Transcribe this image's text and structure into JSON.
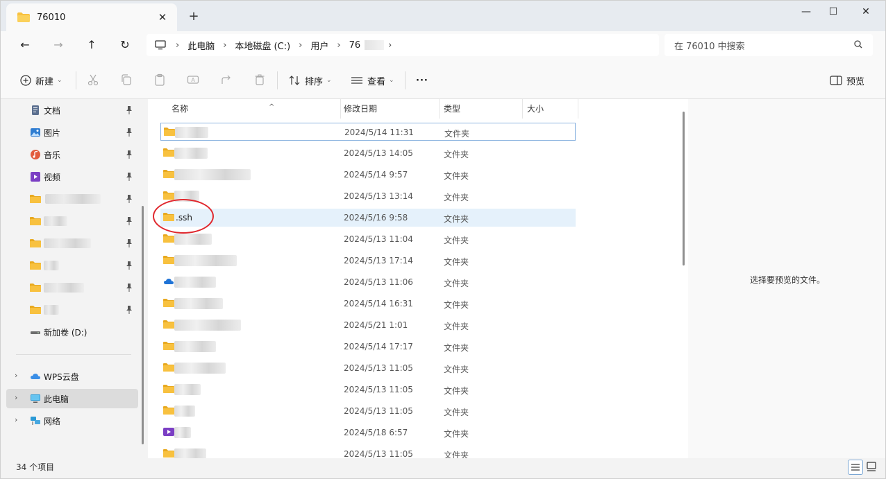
{
  "window": {
    "tab_title": "76010",
    "new_tab": "+",
    "tab_close": "✕",
    "controls": {
      "minimize": "—",
      "maximize": "☐",
      "close": "✕"
    }
  },
  "address": {
    "back": "←",
    "forward": "→",
    "up": "↑",
    "refresh": "↻",
    "breadcrumbs": [
      "此电脑",
      "本地磁盘 (C:)",
      "用户",
      "76"
    ],
    "separator": "›",
    "search_placeholder": "在 76010 中搜索"
  },
  "toolbar": {
    "new_label": "新建",
    "sort_label": "排序",
    "view_label": "查看",
    "more_label": "···",
    "preview_label": "预览",
    "caret": "⌄"
  },
  "sidebar": {
    "items": [
      {
        "label": "文档",
        "icon": "document-icon"
      },
      {
        "label": "图片",
        "icon": "pictures-icon"
      },
      {
        "label": "音乐",
        "icon": "music-icon"
      },
      {
        "label": "视频",
        "icon": "video-icon"
      },
      {
        "label": "",
        "icon": "folder-icon"
      },
      {
        "label": "",
        "icon": "folder-icon"
      },
      {
        "label": "",
        "icon": "folder-icon"
      },
      {
        "label": "",
        "icon": "folder-icon"
      },
      {
        "label": "",
        "icon": "folder-icon"
      },
      {
        "label": "",
        "icon": "folder-icon"
      },
      {
        "label": "新加卷 (D:)",
        "icon": "drive-icon"
      }
    ],
    "roots": [
      {
        "label": "WPS云盘",
        "icon": "cloud-icon"
      },
      {
        "label": "此电脑",
        "icon": "computer-icon"
      },
      {
        "label": "网络",
        "icon": "network-icon"
      }
    ],
    "chevron": "›"
  },
  "columns": {
    "name": "名称",
    "modified": "修改日期",
    "type": "类型",
    "size": "大小",
    "sort_arrow": "^"
  },
  "files": [
    {
      "name": "",
      "date": "2024/5/14 11:31",
      "type": "文件夹",
      "icon": "folder-icon"
    },
    {
      "name": "",
      "date": "2024/5/13 14:05",
      "type": "文件夹",
      "icon": "folder-icon"
    },
    {
      "name": "",
      "date": "2024/5/14 9:57",
      "type": "文件夹",
      "icon": "folder-icon"
    },
    {
      "name": "",
      "date": "2024/5/13 13:14",
      "type": "文件夹",
      "icon": "folder-icon"
    },
    {
      "name": ".ssh",
      "date": "2024/5/16 9:58",
      "type": "文件夹",
      "icon": "folder-icon"
    },
    {
      "name": "",
      "date": "2024/5/13 11:04",
      "type": "文件夹",
      "icon": "folder-icon"
    },
    {
      "name": "",
      "date": "2024/5/13 17:14",
      "type": "文件夹",
      "icon": "folder-icon"
    },
    {
      "name": "",
      "date": "2024/5/13 11:06",
      "type": "文件夹",
      "icon": "onedrive-icon"
    },
    {
      "name": "",
      "date": "2024/5/14 16:31",
      "type": "文件夹",
      "icon": "folder-icon"
    },
    {
      "name": "",
      "date": "2024/5/21 1:01",
      "type": "文件夹",
      "icon": "folder-icon"
    },
    {
      "name": "",
      "date": "2024/5/14 17:17",
      "type": "文件夹",
      "icon": "folder-icon"
    },
    {
      "name": "",
      "date": "2024/5/13 11:05",
      "type": "文件夹",
      "icon": "folder-icon"
    },
    {
      "name": "",
      "date": "2024/5/13 11:05",
      "type": "文件夹",
      "icon": "folder-icon"
    },
    {
      "name": "",
      "date": "2024/5/13 11:05",
      "type": "文件夹",
      "icon": "folder-icon"
    },
    {
      "name": "",
      "date": "2024/5/18 6:57",
      "type": "文件夹",
      "icon": "video-folder-icon"
    },
    {
      "name": "",
      "date": "2024/5/13 11:05",
      "type": "文件夹",
      "icon": "folder-icon"
    }
  ],
  "preview": {
    "message": "选择要预览的文件。"
  },
  "status": {
    "count": "34 个项目"
  },
  "colors": {
    "folder": "#f8c13f",
    "folder_dark": "#e8a91f",
    "selection": "#e5f1fb",
    "focus": "#8cb4e0",
    "annotation": "#e0282e"
  }
}
